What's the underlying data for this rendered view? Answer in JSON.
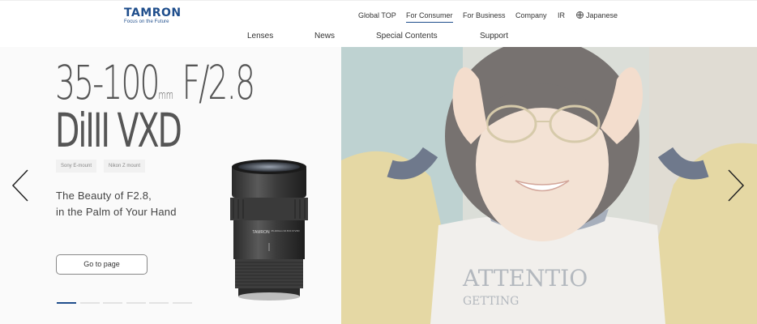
{
  "header": {
    "logo_text": "TAMRON",
    "logo_tagline": "Focus on the Future",
    "top_nav": [
      {
        "label": "Global TOP"
      },
      {
        "label": "For Consumer",
        "active": true
      },
      {
        "label": "For Business"
      },
      {
        "label": "Company"
      },
      {
        "label": "IR"
      },
      {
        "label": "Japanese",
        "icon": "globe-icon"
      }
    ],
    "main_nav": [
      {
        "label": "Lenses"
      },
      {
        "label": "News"
      },
      {
        "label": "Special Contents"
      },
      {
        "label": "Support"
      }
    ]
  },
  "hero": {
    "product_line1": "35-100",
    "product_unit": "mm",
    "product_aperture": "F/2.8",
    "product_line2": "DiIII VXD",
    "mounts": [
      "Sony E-mount",
      "Nikon Z mount"
    ],
    "tagline_line1": "The Beauty of F2.8,",
    "tagline_line2": "in the Palm of Your Hand",
    "button_label": "Go to page",
    "lens_brand": "TAMRON",
    "lens_label": "35-100mm F2.8 Di III VXD",
    "slide_count": 6,
    "active_slide": 1,
    "shirt_text_1": "ATTENTIO",
    "shirt_text_2": "GETTING"
  },
  "colors": {
    "brand": "#1f4e8c",
    "hero_left_bg": "#fafafa"
  },
  "icons": [
    "globe-icon",
    "chevron-left-icon",
    "chevron-right-icon"
  ]
}
